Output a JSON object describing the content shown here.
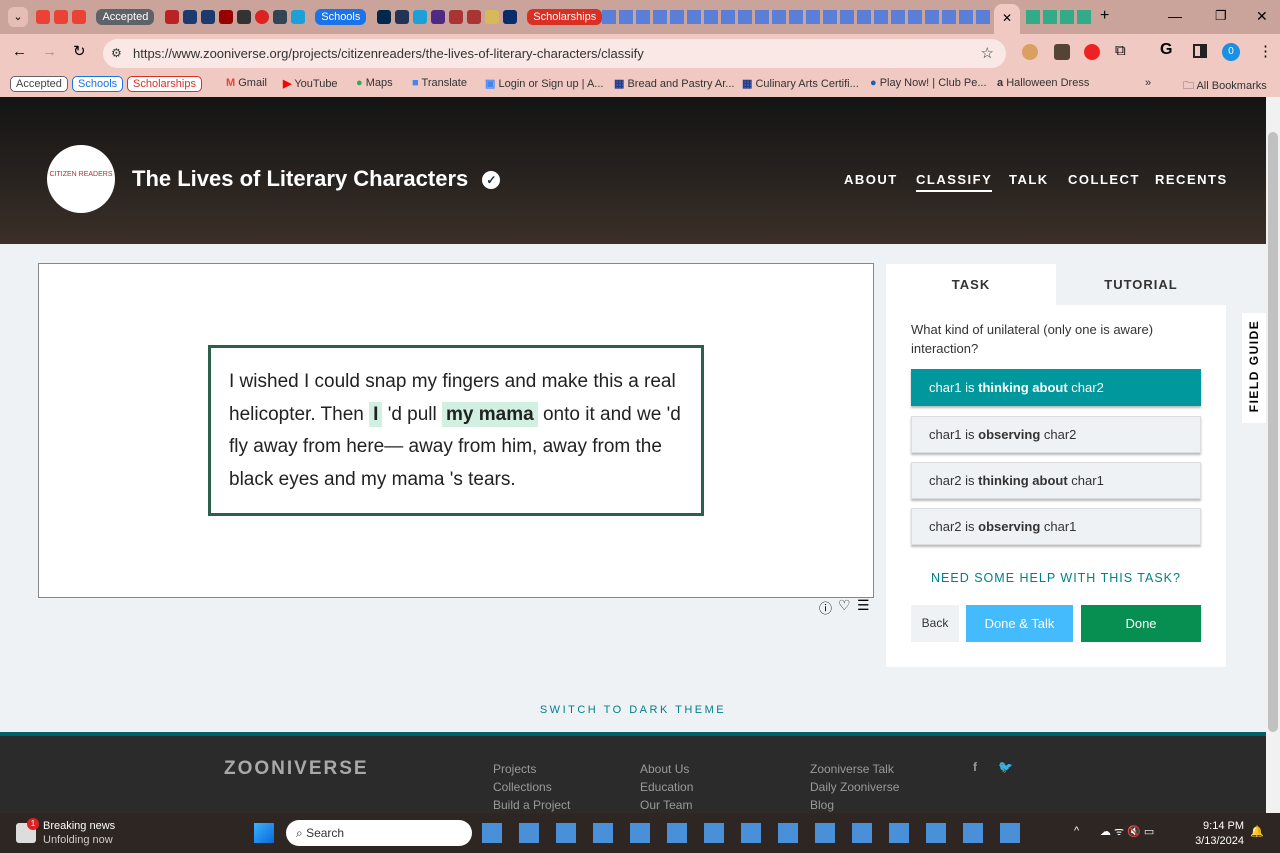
{
  "browser": {
    "tab_groups": [
      {
        "label": "Accepted",
        "color": "#5f6368"
      },
      {
        "label": "Schools",
        "color": "#1a73e8"
      },
      {
        "label": "Scholarships",
        "color": "#d93025"
      }
    ],
    "url": "https://www.zooniverse.org/projects/citizenreaders/the-lives-of-literary-characters/classify",
    "profile_initial": "0",
    "bookmarks": [
      "Accepted",
      "Schools",
      "Scholarships",
      "Gmail",
      "YouTube",
      "Maps",
      "Translate",
      "Login or Sign up | A...",
      "Bread and Pastry Ar...",
      "Culinary Arts Certifi...",
      "Play Now! | Club Pe...",
      "Halloween Dress",
      "All Bookmarks"
    ]
  },
  "project": {
    "logo_text": "CITIZEN READERS",
    "title": "The Lives of Literary Characters",
    "nav": [
      "ABOUT",
      "CLASSIFY",
      "TALK",
      "COLLECT",
      "RECENTS"
    ]
  },
  "subject": {
    "text_before": "I wished I could snap my fingers and make this a real helicopter. Then ",
    "hl1": "I",
    "text_mid": " 'd pull ",
    "hl2": "my mama",
    "text_after": " onto it and we 'd fly away from here— away from him, away from the black eyes and my mama 's tears."
  },
  "task": {
    "tabs": [
      "TASK",
      "TUTORIAL"
    ],
    "question": "What kind of unilateral (only one is aware) interaction?",
    "answers": [
      {
        "a": "char1 is ",
        "b": "thinking about",
        "c": " char2",
        "selected": true
      },
      {
        "a": "char1 is ",
        "b": "observing",
        "c": " char2",
        "selected": false
      },
      {
        "a": "char2 is ",
        "b": "thinking about",
        "c": " char1",
        "selected": false
      },
      {
        "a": "char2 is ",
        "b": "observing",
        "c": " char1",
        "selected": false
      }
    ],
    "help": "NEED SOME HELP WITH THIS TASK?",
    "back": "Back",
    "done_talk": "Done & Talk",
    "done": "Done",
    "field_guide": "FIELD GUIDE"
  },
  "theme_switch": "SWITCH TO DARK THEME",
  "footer": {
    "logo": "ZOONIVERSE",
    "col1": [
      "Projects",
      "Collections",
      "Build a Project"
    ],
    "col2": [
      "About Us",
      "Education",
      "Our Team"
    ],
    "col3": [
      "Zooniverse Talk",
      "Daily Zooniverse",
      "Blog"
    ]
  },
  "taskbar": {
    "news_title": "Breaking news",
    "news_sub": "Unfolding now",
    "news_badge": "1",
    "search": "Search",
    "time": "9:14 PM",
    "date": "3/13/2024"
  },
  "colors": {
    "accent": "#00979d",
    "done": "#078f52",
    "done_talk": "#43bbfd"
  }
}
